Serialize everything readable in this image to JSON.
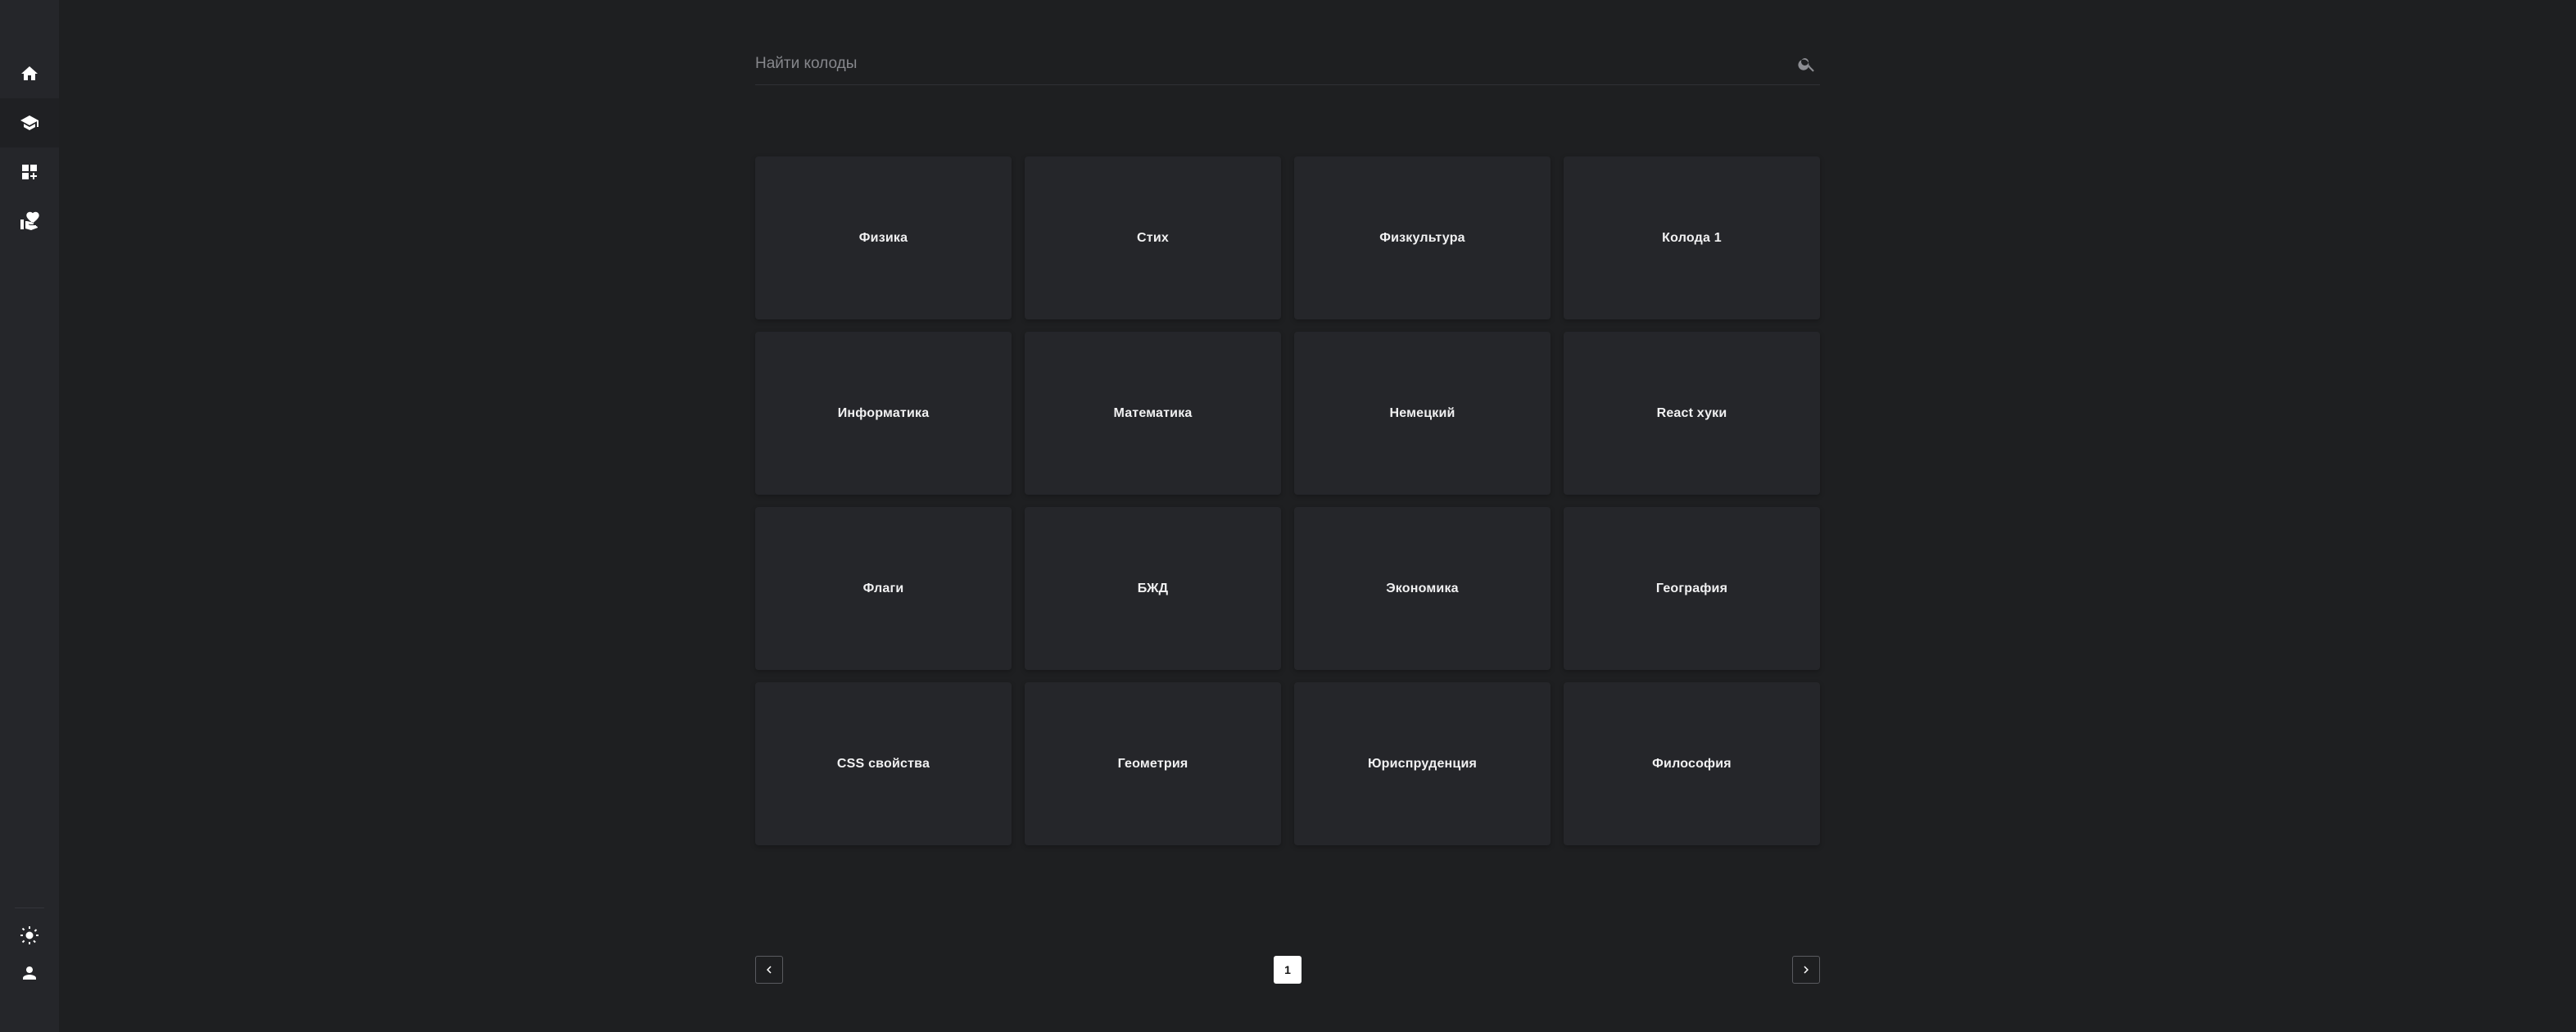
{
  "sidebar": {
    "top_items": [
      {
        "icon": "home-icon"
      },
      {
        "icon": "graduation-cap-icon"
      },
      {
        "icon": "dashboard-add-icon"
      },
      {
        "icon": "volunteer-hand-heart-icon"
      }
    ],
    "bottom_items": [
      {
        "icon": "sun-icon"
      },
      {
        "icon": "user-icon"
      }
    ]
  },
  "search": {
    "placeholder": "Найти колоды",
    "value": ""
  },
  "decks": [
    "Физика",
    "Стих",
    "Физкультура",
    "Колода 1",
    "Информатика",
    "Математика",
    "Немецкий",
    "React хуки",
    "Флаги",
    "БЖД",
    "Экономика",
    "География",
    "CSS свойства",
    "Геометрия",
    "Юриспруденция",
    "Философия"
  ],
  "pagination": {
    "current_page": "1",
    "prev_icon": "chevron-left-icon",
    "next_icon": "chevron-right-icon"
  },
  "colors": {
    "background": "#1e1f21",
    "sidebar": "#25262a",
    "card": "#25262a",
    "text": "#f1f1f2",
    "muted": "#86878c"
  }
}
